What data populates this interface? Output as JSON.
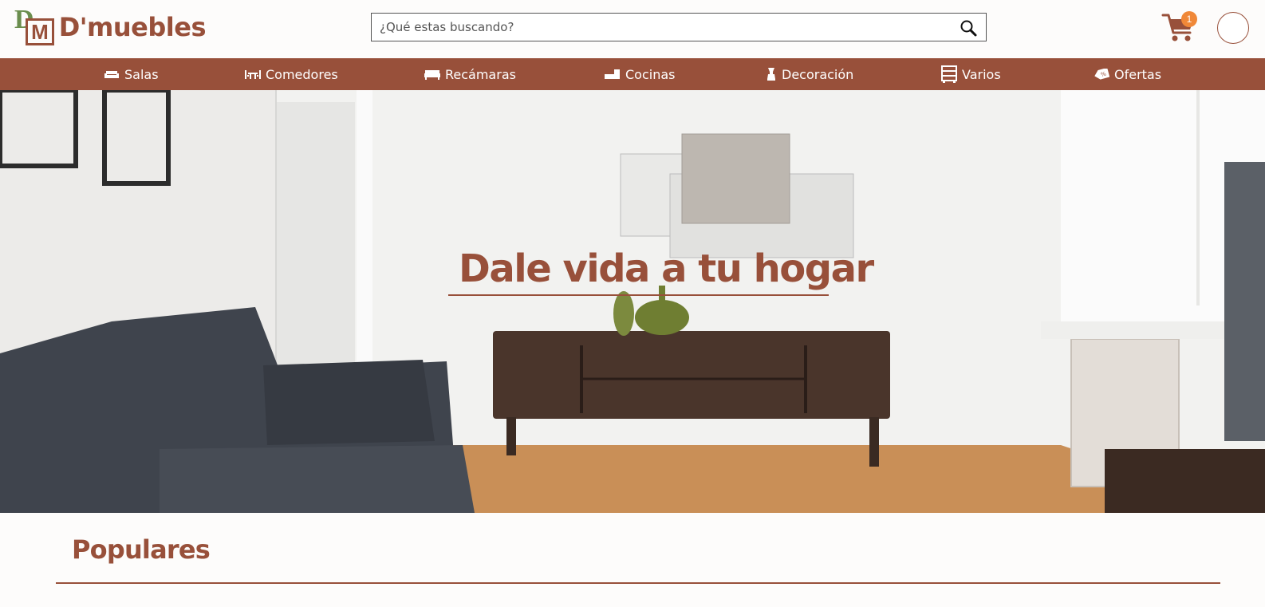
{
  "brand": {
    "logo_d": "D",
    "logo_m": "M",
    "name": "D'muebles"
  },
  "search": {
    "placeholder": "¿Qué estas buscando?",
    "icon": "search-icon"
  },
  "cart": {
    "icon": "cart-icon",
    "count": "1"
  },
  "nav": {
    "items": [
      {
        "label": "Salas",
        "icon": "sofa-icon"
      },
      {
        "label": "Comedores",
        "icon": "dining-table-icon"
      },
      {
        "label": "Recámaras",
        "icon": "bed-icon"
      },
      {
        "label": "Cocinas",
        "icon": "kitchen-icon"
      },
      {
        "label": "Decoración",
        "icon": "lamp-icon"
      },
      {
        "label": "Varios",
        "icon": "dresser-icon"
      },
      {
        "label": "Ofertas",
        "icon": "discount-tag-icon"
      }
    ]
  },
  "hero": {
    "title": "Dale vida a tu hogar"
  },
  "sections": {
    "popular_title": "Populares"
  },
  "colors": {
    "brand": "#98503a",
    "logo_green": "#6b8e4e",
    "badge": "#f08838",
    "background": "#fdfcfb"
  }
}
